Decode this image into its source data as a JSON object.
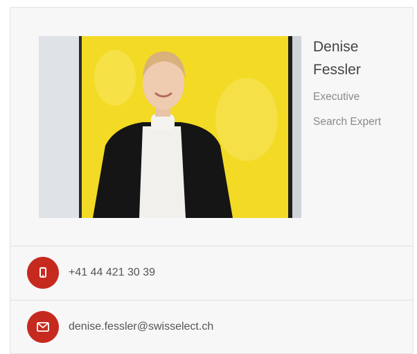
{
  "profile": {
    "first_name": "Denise",
    "last_name": "Fessler",
    "title_line1": "Executive",
    "title_line2": "Search Expert",
    "photo_icon": "portrait-photo"
  },
  "contacts": {
    "phone": {
      "icon": "mobile-phone-icon",
      "value": "+41 44 421 30 39"
    },
    "email": {
      "icon": "envelope-icon",
      "value": "denise.fessler@swisselect.ch"
    }
  },
  "colors": {
    "accent": "#c62a1f",
    "card_background": "#f7f7f7",
    "photo_backdrop": "#f2d81a"
  }
}
